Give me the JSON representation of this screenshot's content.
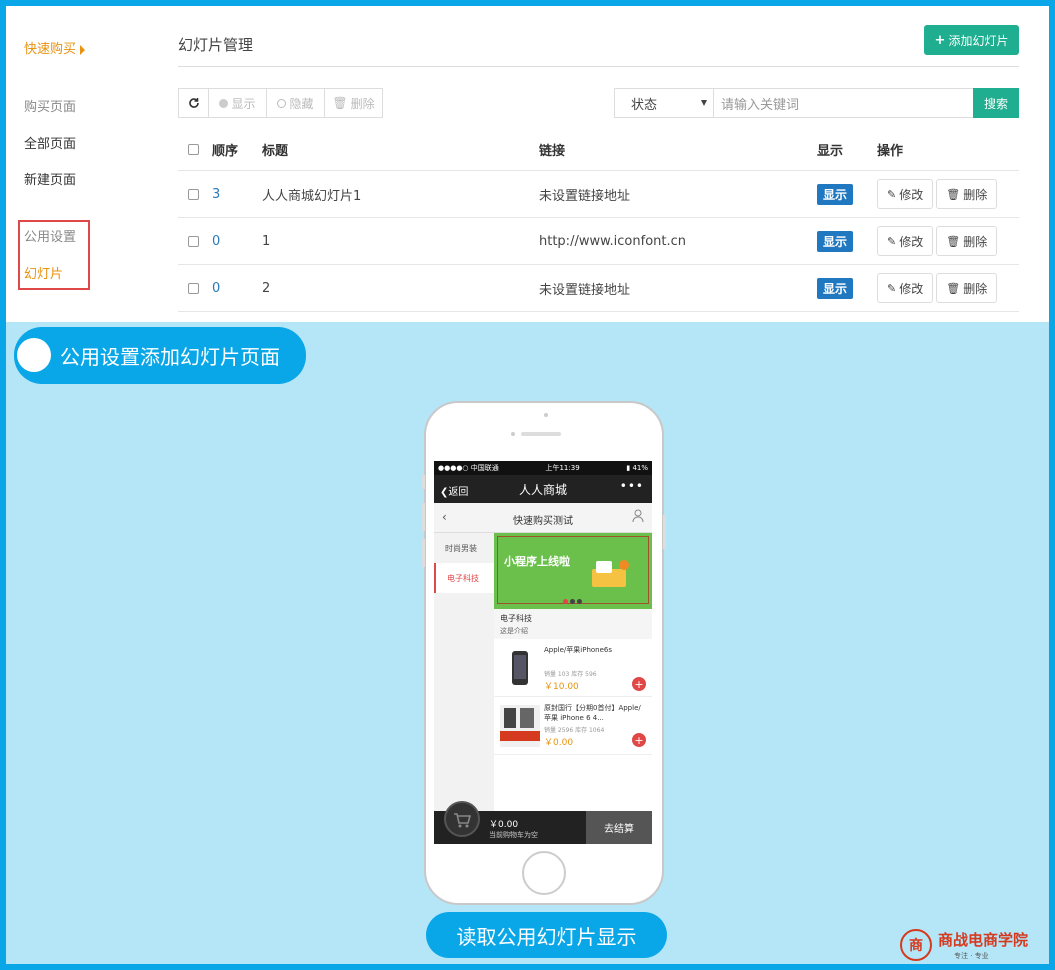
{
  "sidebar": {
    "title": "快速购买",
    "items": [
      {
        "label": "购买页面"
      },
      {
        "label": "全部页面"
      },
      {
        "label": "新建页面"
      },
      {
        "label": "公用设置"
      },
      {
        "label": "幻灯片"
      }
    ]
  },
  "header": {
    "title": "幻灯片管理",
    "add_label": "添加幻灯片"
  },
  "toolbar": {
    "show_label": "显示",
    "hide_label": "隐藏",
    "delete_label": "删除"
  },
  "filter": {
    "status_label": "状态",
    "search_placeholder": "请输入关键词",
    "search_label": "搜索"
  },
  "table": {
    "columns": [
      "顺序",
      "标题",
      "链接",
      "显示",
      "操作"
    ],
    "rows": [
      {
        "order": "3",
        "title": "人人商城幻灯片1",
        "link": "未设置链接地址",
        "status": "显示",
        "edit": "修改",
        "delete": "删除"
      },
      {
        "order": "0",
        "title": "1",
        "link": "http://www.iconfont.cn",
        "status": "显示",
        "edit": "修改",
        "delete": "删除"
      },
      {
        "order": "0",
        "title": "2",
        "link": "未设置链接地址",
        "status": "显示",
        "edit": "修改",
        "delete": "删除"
      }
    ]
  },
  "captions": {
    "top": "公用设置添加幻灯片页面",
    "bottom": "读取公用幻灯片显示"
  },
  "phone": {
    "status_carrier": "●●●●○ 中国联通",
    "status_time": "上午11:39",
    "status_battery": "41%",
    "back_label": "返回",
    "app_title": "人人商城",
    "page_title": "快速购买测试",
    "categories": [
      "时尚男装",
      "电子科技"
    ],
    "slide_title": "小程序上线啦",
    "section_title": "电子科技",
    "section_sub": "这是介绍",
    "products": [
      {
        "name": "Apple/苹果iPhone6s",
        "meta": "销量 103 库存 596",
        "price": "￥10.00"
      },
      {
        "name": "原封国行【分期0首付】Apple/苹果 iPhone 6 4...",
        "meta": "销量 2596 库存 1064",
        "price": "￥0.00"
      }
    ],
    "cart_amount": "￥0.00",
    "cart_empty": "当前购物车为空",
    "checkout_label": "去结算"
  },
  "logo": {
    "brand": "商战电商学院",
    "slogan": "专注 · 专业"
  },
  "colors": {
    "accent_green": "#1fae8f",
    "accent_orange": "#e8920e",
    "accent_blue": "#0aa7e8",
    "badge_blue": "#2078c0",
    "highlight_red": "#e04848"
  }
}
